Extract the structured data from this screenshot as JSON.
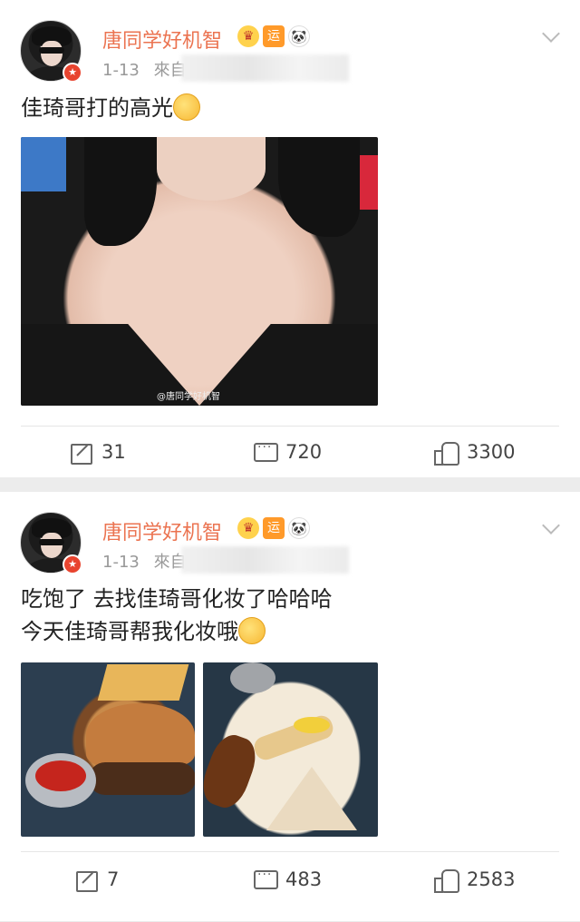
{
  "posts": [
    {
      "username": "唐同学好机智",
      "badge_labels": {
        "crown": "♛",
        "yun": "运",
        "panda": "🐼"
      },
      "date": "1-13",
      "source_prefix": "來自",
      "text": "佳琦哥打的高光",
      "image_watermark": "@唐同学好机智",
      "stats": {
        "shares": "31",
        "comments": "720",
        "likes": "3300"
      }
    },
    {
      "username": "唐同学好机智",
      "badge_labels": {
        "crown": "♛",
        "yun": "运",
        "panda": "🐼"
      },
      "date": "1-13",
      "source_prefix": "來自",
      "text_line1": "吃饱了 去找佳琦哥化妆了哈哈哈",
      "text_line2": "今天佳琦哥帮我化妆哦",
      "stats": {
        "shares": "7",
        "comments": "483",
        "likes": "2583"
      }
    }
  ],
  "colors": {
    "username": "#eb7350",
    "meta": "#999999",
    "divider": "#e6e6e6",
    "background": "#ececec"
  },
  "icons": [
    "chevron-down-icon",
    "share-icon",
    "comment-icon",
    "like-icon",
    "verified-badge-icon"
  ]
}
